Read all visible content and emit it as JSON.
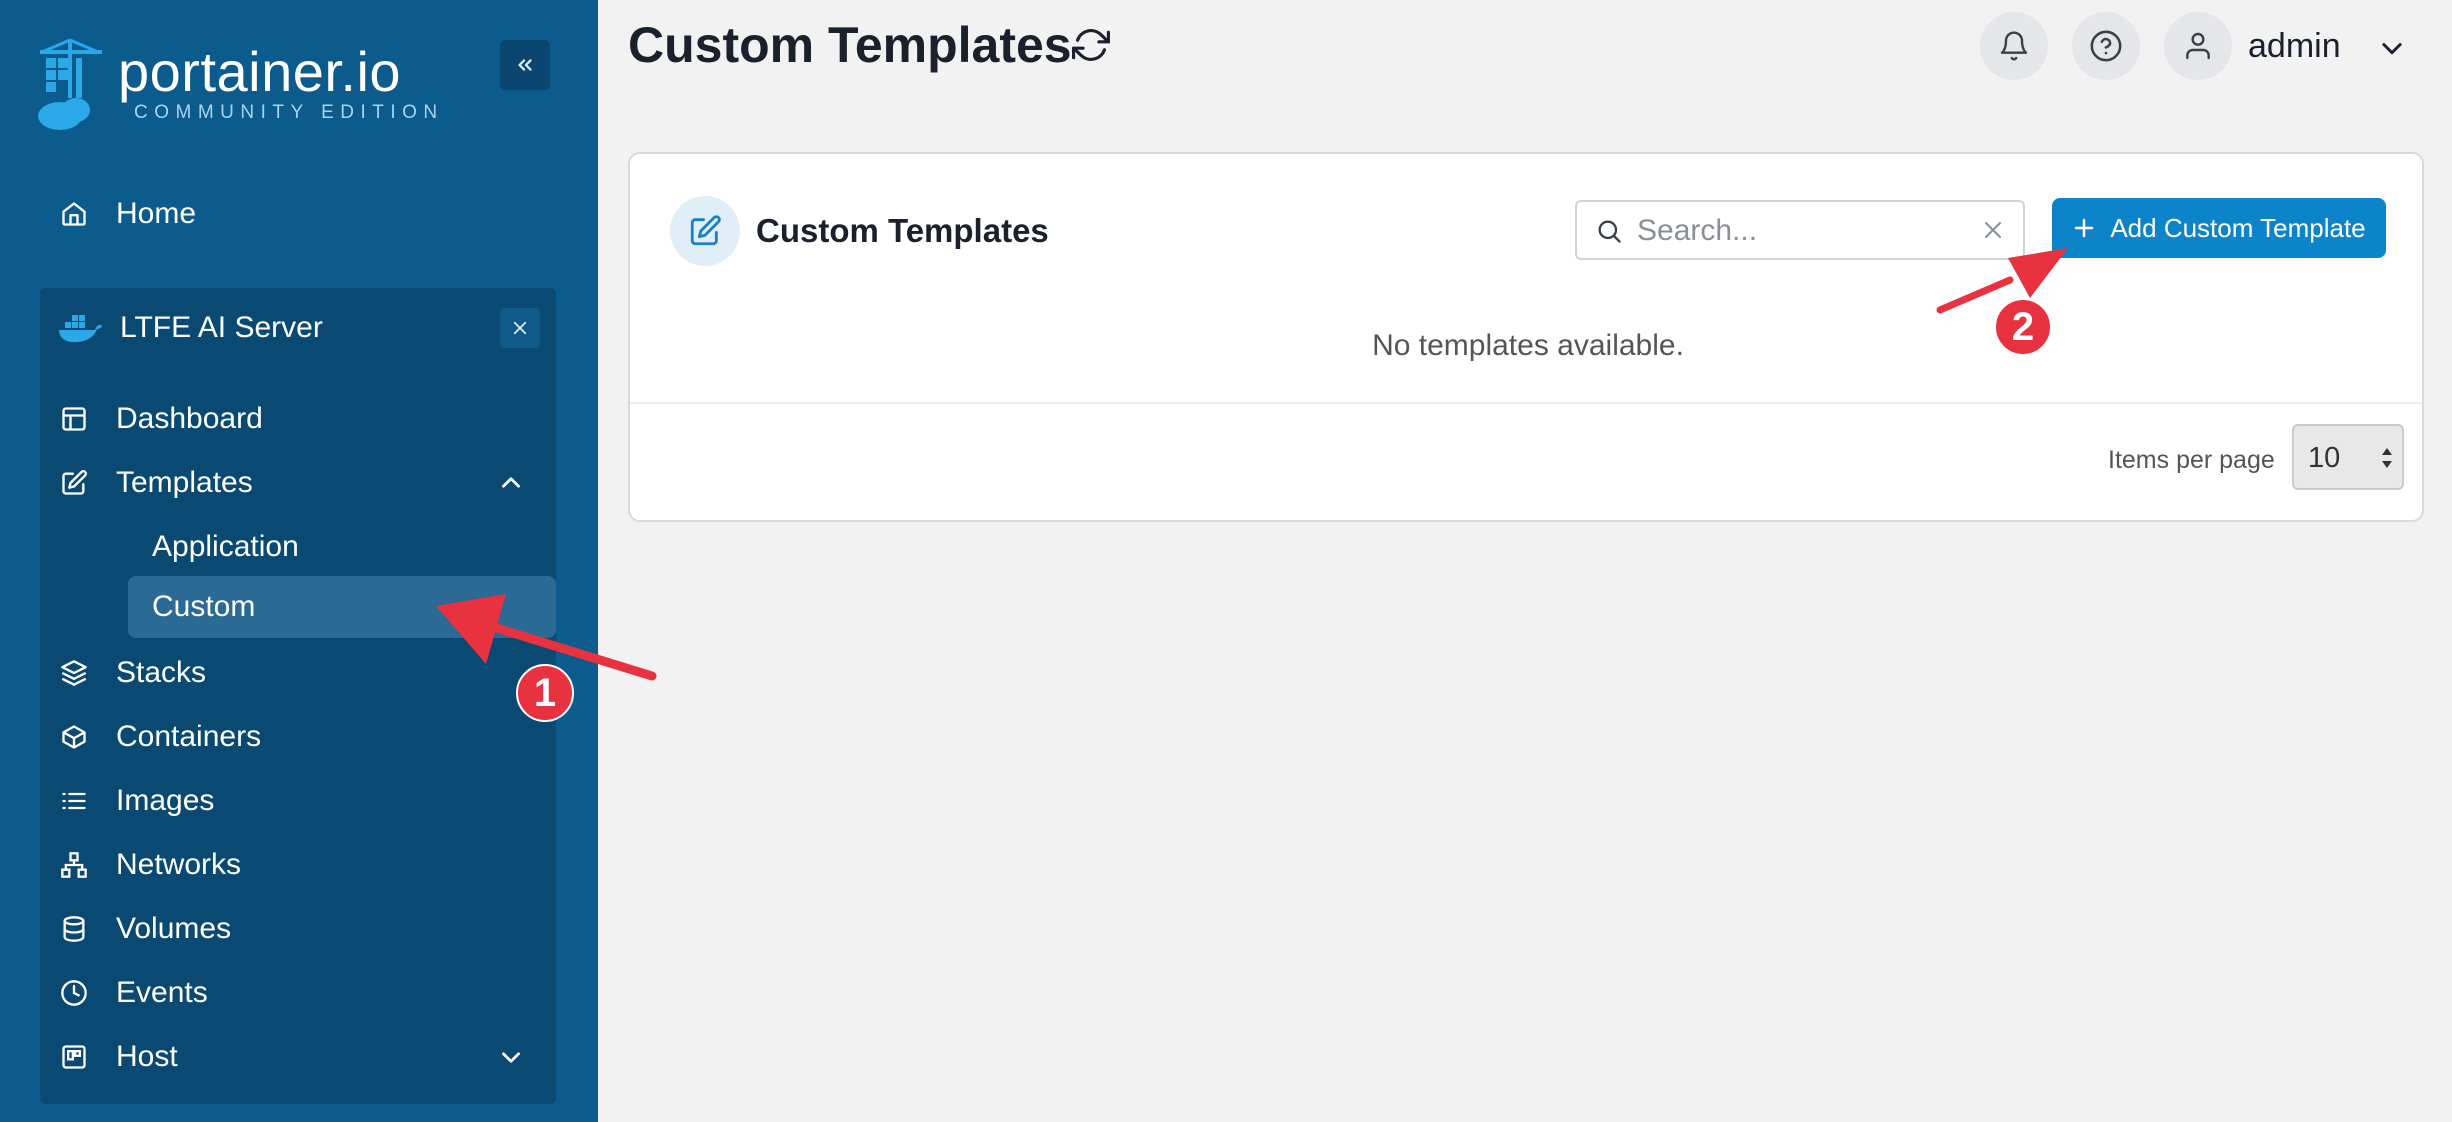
{
  "brand": {
    "name": "portainer.io",
    "edition": "COMMUNITY EDITION"
  },
  "sidebar": {
    "home_label": "Home",
    "environment": {
      "name": "LTFE AI Server",
      "items": [
        {
          "label": "Dashboard",
          "icon": "dashboard-icon"
        },
        {
          "label": "Templates",
          "icon": "edit-icon"
        },
        {
          "label": "Stacks",
          "icon": "layers-icon"
        },
        {
          "label": "Containers",
          "icon": "box-icon"
        },
        {
          "label": "Images",
          "icon": "list-icon"
        },
        {
          "label": "Networks",
          "icon": "network-icon"
        },
        {
          "label": "Volumes",
          "icon": "database-icon"
        },
        {
          "label": "Events",
          "icon": "clock-icon"
        },
        {
          "label": "Host",
          "icon": "host-icon"
        }
      ],
      "template_subitems": [
        {
          "label": "Application",
          "active": false
        },
        {
          "label": "Custom",
          "active": true
        }
      ]
    }
  },
  "header": {
    "title": "Custom Templates",
    "user": "admin"
  },
  "card": {
    "title": "Custom Templates",
    "search_placeholder": "Search...",
    "add_button": "Add Custom Template",
    "empty_message": "No templates available.",
    "items_per_page_label": "Items per page",
    "items_per_page_value": "10"
  },
  "annotations": {
    "step1": "1",
    "step2": "2"
  },
  "colors": {
    "sidebar_bg": "#0b5c8c",
    "accent": "#0d84c9",
    "annotation": "#e8323f"
  }
}
